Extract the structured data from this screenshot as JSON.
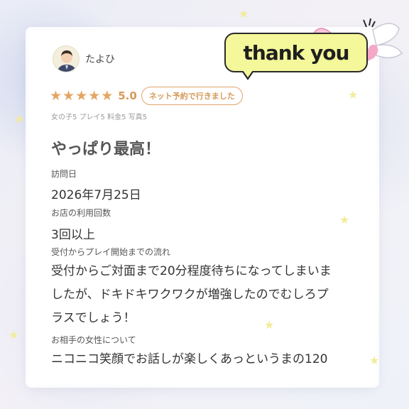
{
  "reviewer": {
    "name": "たよひ",
    "avatar_icon": "person-avatar-icon"
  },
  "rating": {
    "stars": 5,
    "score": "5.0",
    "badge": "ネット予約で行きました",
    "sub_scores": "女の子5 プレイ5 料金5 写真5",
    "color": "#e3a561"
  },
  "review": {
    "title": "やっぱり最高！",
    "visit_date_label": "訪問日",
    "visit_date": "2026年7月25日",
    "visit_count_label": "お店の利用回数",
    "visit_count": "3回以上",
    "flow_label": "受付からプレイ開始までの流れ",
    "flow_lines": [
      "受付からご対面まで20分程度待ちになってしまいま",
      "したが、ドキドキワクワクが増強したのでむしろプ",
      "ラスでしょう！"
    ],
    "partner_label": "お相手の女性について",
    "partner_line": "ニコニコ笑顔でお話しが楽しくあっというまの120"
  },
  "sticker": {
    "text": "thank you",
    "color": "#f4f79a"
  }
}
